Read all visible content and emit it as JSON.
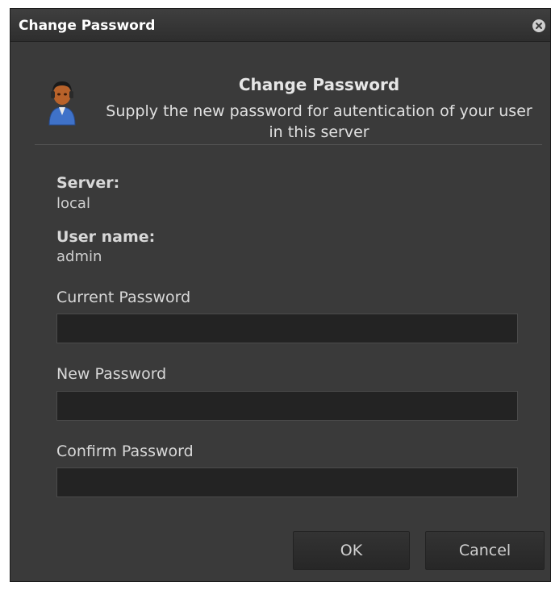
{
  "window": {
    "title": "Change Password",
    "close_icon": "close-circle-icon"
  },
  "header": {
    "icon": "user-icon",
    "title": "Change Password",
    "description": "Supply the new password for autentication of your user in this server"
  },
  "info": {
    "server_label": "Server:",
    "server_value": "local",
    "username_label": "User name:",
    "username_value": "admin"
  },
  "fields": {
    "current_password_label": "Current Password",
    "current_password_value": "",
    "new_password_label": "New Password",
    "new_password_value": "",
    "confirm_password_label": "Confirm Password",
    "confirm_password_value": ""
  },
  "buttons": {
    "ok_label": "OK",
    "cancel_label": "Cancel"
  },
  "colors": {
    "dialog_bg": "#3a3a3a",
    "titlebar_bg": "#2e2e2e",
    "input_bg": "#232323",
    "text": "#d8d8d8"
  }
}
